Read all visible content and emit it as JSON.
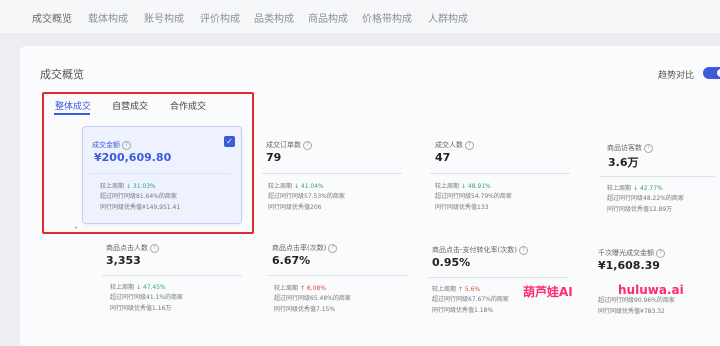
{
  "nav": {
    "tabs": [
      "成交概览",
      "载体构成",
      "账号构成",
      "评价构成",
      "品类构成",
      "商品构成",
      "价格带构成",
      "人群构成"
    ]
  },
  "overview": {
    "title": "成交概览",
    "trend_label": "趋势对比",
    "trend_on": true,
    "subtabs": [
      "整体成交",
      "自营成交",
      "合作成交"
    ]
  },
  "metrics": [
    {
      "label": "成交金额",
      "value": "¥200,609.80",
      "cmp_label": "较上周期",
      "change": "31.03%",
      "dir": "down",
      "line2": "超过同行同级81.64%的商家",
      "line3": "同行同级优秀值¥149,951.41"
    },
    {
      "label": "成交订单数",
      "value": "79",
      "cmp_label": "较上周期",
      "change": "41.04%",
      "dir": "down",
      "line2": "超过同行同级57.53%的商家",
      "line3": "同行同级优秀值206"
    },
    {
      "label": "成交人数",
      "value": "47",
      "cmp_label": "较上周期",
      "change": "48.91%",
      "dir": "down",
      "line2": "超过同行同级54.79%的商家",
      "line3": "同行同级优秀值133"
    },
    {
      "label": "商品访客数",
      "value": "3.6万",
      "cmp_label": "较上周期",
      "change": "42.77%",
      "dir": "down",
      "line2": "超过同行同级48.22%的商家",
      "line3": "同行同级优秀值12.89万"
    },
    {
      "label": "商品点击人数",
      "value": "3,353",
      "cmp_label": "较上周期",
      "change": "47.45%",
      "dir": "down",
      "line2": "超过同行同级41.1%的商家",
      "line3": "同行同级优秀值1.16万"
    },
    {
      "label": "商品点击率(次数)",
      "value": "6.67%",
      "cmp_label": "较上周期",
      "change": "6.08%",
      "dir": "up",
      "line2": "超过同行同级65.48%的商家",
      "line3": "同行同级优秀值7.15%"
    },
    {
      "label": "商品点击-支付转化率(次数)",
      "value": "0.95%",
      "cmp_label": "较上周期",
      "change": "5.6%",
      "dir": "up",
      "line2": "超过同行同级67.67%的商家",
      "line3": "同行同级优秀值1.18%"
    },
    {
      "label": "千次曝光成交金额",
      "value": "¥1,608.39",
      "cmp_label": "较上周期",
      "change": "",
      "dir": "",
      "line2": "超过同行同级90.96%的商家",
      "line3": "同行同级优秀值¥783.32"
    }
  ],
  "watermark": {
    "brand": "葫芦娃AI",
    "site": "huluwa.ai"
  },
  "colors": {
    "accent": "#3d5bd9",
    "highlight": "#e02b2b",
    "up": "#e0483d",
    "down": "#3aa36b",
    "watermark": "#ff2b6b"
  }
}
